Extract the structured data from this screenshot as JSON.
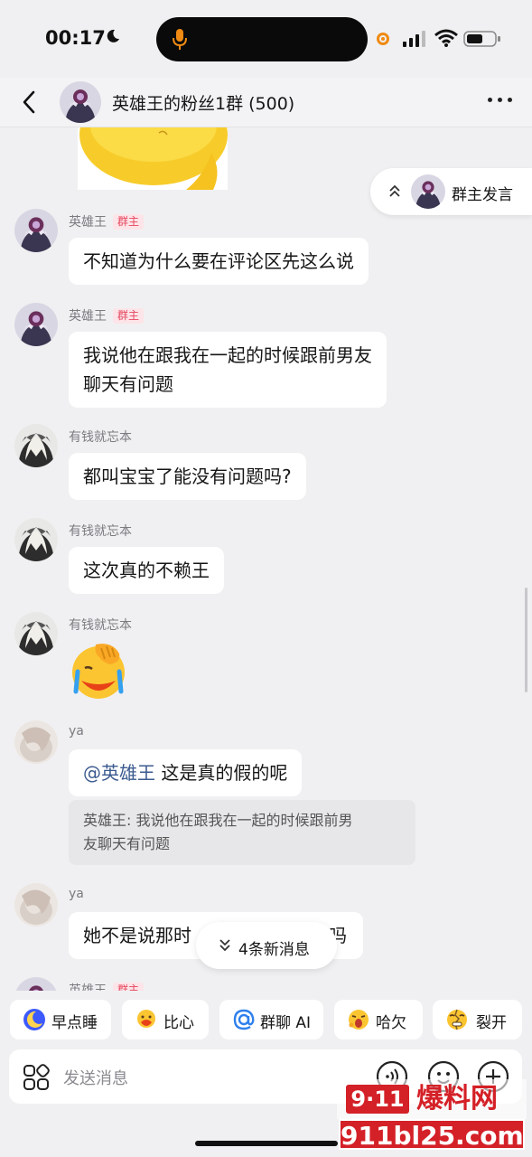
{
  "status": {
    "time": "00:17"
  },
  "header": {
    "title": "英雄王的粉丝1群 (500)"
  },
  "owner_banner": {
    "label": "群主发言"
  },
  "messages": [
    {
      "sender": "英雄王",
      "badge": "群主",
      "text": "不知道为什么要在评论区先这么说"
    },
    {
      "sender": "英雄王",
      "badge": "群主",
      "text_line1": "我说他在跟我在一起的时候跟前男友",
      "text_line2": "聊天有问题"
    },
    {
      "sender": "有钱就忘本",
      "text": "都叫宝宝了能没有问题吗?"
    },
    {
      "sender": "有钱就忘本",
      "text": "这次真的不赖王"
    },
    {
      "sender": "有钱就忘本",
      "emoji": "facepalm-crying-emoji"
    },
    {
      "sender": "ya",
      "mention": "@英雄王",
      "text": " 这是真的假的呢",
      "quote_line1": "英雄王:  我说他在跟我在一起的时候跟前男",
      "quote_line2": "友聊天有问题"
    },
    {
      "sender": "ya",
      "text_visible_left": "她不是说那时",
      "text_visible_right": "吗"
    },
    {
      "sender": "英雄王",
      "badge": "群主"
    }
  ],
  "new_messages": {
    "label": "4条新消息"
  },
  "quick_replies": [
    {
      "label": "早点睡",
      "icon": "moon-icon"
    },
    {
      "label": "比心",
      "icon": "heart-hands-icon"
    },
    {
      "label": "群聊 AI",
      "icon": "at-icon"
    },
    {
      "label": "哈欠",
      "icon": "yawn-icon"
    },
    {
      "label": "裂开",
      "icon": "broken-face-icon"
    }
  ],
  "input": {
    "placeholder": "发送消息"
  },
  "watermark": {
    "logo": "9·11",
    "name": "爆料网",
    "url": "911bl25.com"
  },
  "colors": {
    "background": "#f0f0f2",
    "badge_text": "#e5465e",
    "badge_bg": "#fde4e8",
    "mention": "#3b5a8f",
    "watermark": "#d42027"
  }
}
